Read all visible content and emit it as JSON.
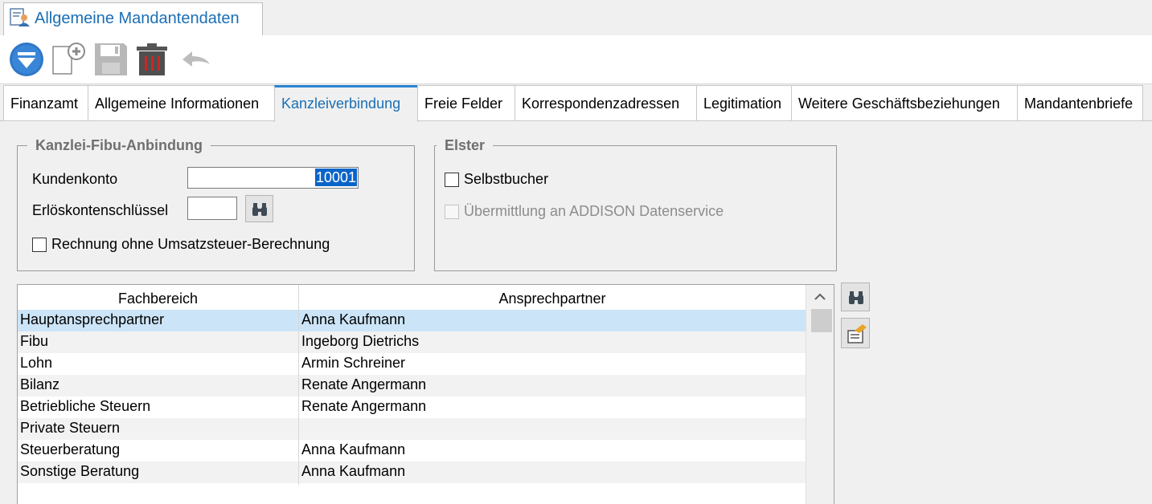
{
  "window_tab": {
    "title": "Allgemeine Mandantendaten",
    "icon": "client-data-icon"
  },
  "toolbar": {
    "buttons": [
      {
        "name": "filter-dropdown",
        "icon": "blue-circle-down-icon"
      },
      {
        "name": "new-document",
        "icon": "new-document-plus-icon"
      },
      {
        "name": "save",
        "icon": "save-icon"
      },
      {
        "name": "delete",
        "icon": "trash-icon"
      },
      {
        "name": "undo",
        "icon": "undo-icon"
      }
    ]
  },
  "tabs": [
    {
      "label": "Finanzamt"
    },
    {
      "label": "Allgemeine Informationen"
    },
    {
      "label": "Kanzleiverbindung",
      "active": true
    },
    {
      "label": "Freie Felder"
    },
    {
      "label": "Korrespondenzadressen"
    },
    {
      "label": "Legitimation"
    },
    {
      "label": "Weitere Geschäftsbeziehungen"
    },
    {
      "label": "Mandantenbriefe"
    }
  ],
  "kanzlei": {
    "title": "Kanzlei-Fibu-Anbindung",
    "kundenkonto_label": "Kundenkonto",
    "kundenkonto_value": "10001",
    "erloes_label": "Erlöskontenschlüssel",
    "erloes_value": "",
    "rechnung_label": "Rechnung ohne Umsatzsteuer-Berechnung",
    "rechnung_checked": false
  },
  "elster": {
    "title": "Elster",
    "selbstbucher_label": "Selbstbucher",
    "selbstbucher_checked": false,
    "uebermittlung_label": "Übermittlung an ADDISON Datenservice",
    "uebermittlung_enabled": false
  },
  "grid": {
    "columns": [
      "Fachbereich",
      "Ansprechpartner"
    ],
    "rows": [
      [
        "Hauptansprechpartner",
        "Anna Kaufmann"
      ],
      [
        "Fibu",
        "Ingeborg Dietrichs"
      ],
      [
        "Lohn",
        "Armin Schreiner"
      ],
      [
        "Bilanz",
        "Renate Angermann"
      ],
      [
        "Betriebliche Steuern",
        "Renate Angermann"
      ],
      [
        "Private Steuern",
        ""
      ],
      [
        "Steuerberatung",
        "Anna Kaufmann"
      ],
      [
        "Sonstige Beratung",
        "Anna Kaufmann"
      ]
    ],
    "selected_row": 0
  },
  "colors": {
    "accent": "#1a6fb5",
    "selection": "#cce4f7",
    "row_alt": "#f2f2f2",
    "text_selection": "#0a64c8"
  }
}
